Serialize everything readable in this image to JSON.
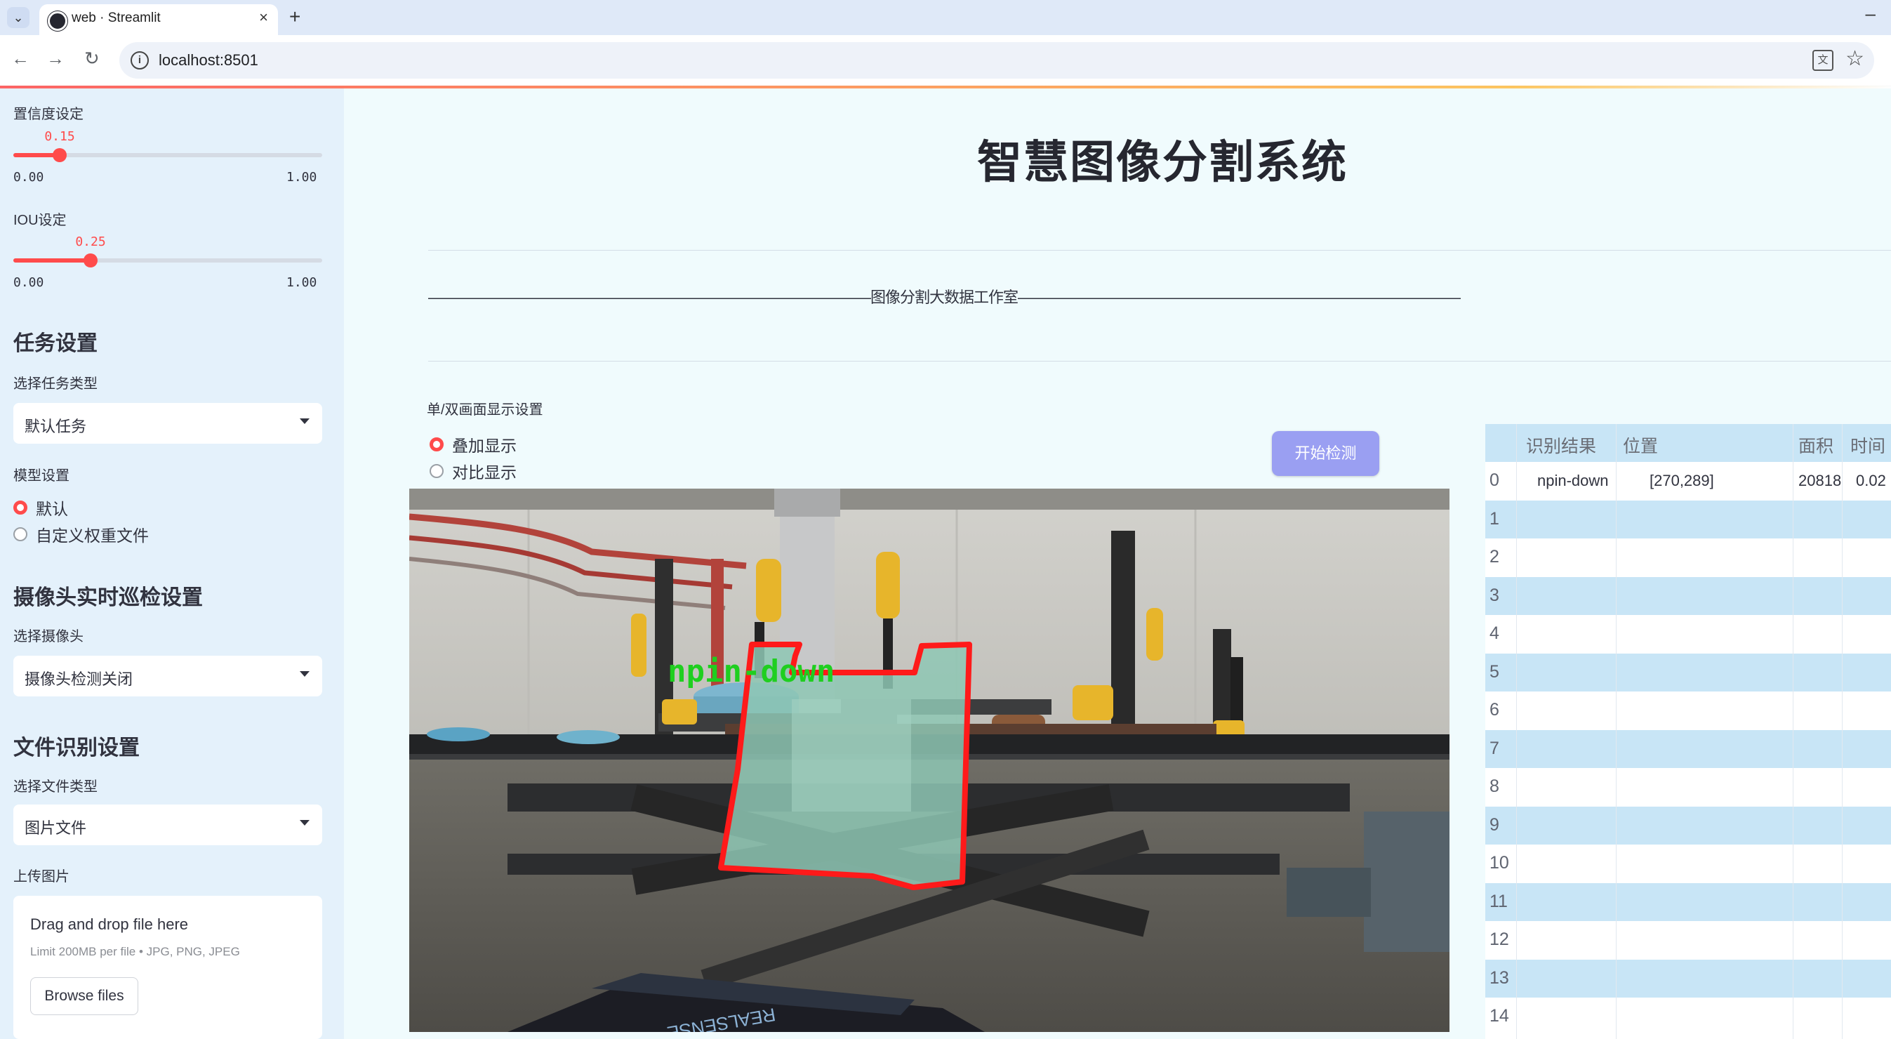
{
  "browser": {
    "tab_title": "web · Streamlit",
    "tab_close": "×",
    "new_tab": "+",
    "minimize": "–",
    "url": "localhost:8501",
    "back": "←",
    "forward": "→",
    "reload": "↻",
    "info_glyph": "i",
    "translate_glyph": "文",
    "star_glyph": "☆"
  },
  "sidebar": {
    "confidence": {
      "label": "置信度设定",
      "value": "0.15",
      "value_fraction": 0.15,
      "min": "0.00",
      "max": "1.00"
    },
    "iou": {
      "label": "IOU设定",
      "value": "0.25",
      "value_fraction": 0.25,
      "min": "0.00",
      "max": "1.00"
    },
    "task_heading": "任务设置",
    "task_type_label": "选择任务类型",
    "task_type_value": "默认任务",
    "model_label": "模型设置",
    "model_options": [
      {
        "label": "默认",
        "selected": true
      },
      {
        "label": "自定义权重文件",
        "selected": false
      }
    ],
    "camera_heading": "摄像头实时巡检设置",
    "camera_label": "选择摄像头",
    "camera_value": "摄像头检测关闭",
    "file_heading": "文件识别设置",
    "file_type_label": "选择文件类型",
    "file_type_value": "图片文件",
    "upload_label": "上传图片",
    "upload": {
      "drop_text": "Drag and drop file here",
      "limit_text": "Limit 200MB per file • JPG, PNG, JPEG",
      "browse_label": "Browse files"
    }
  },
  "main": {
    "title": "智慧图像分割系统",
    "banner": "——————————————————————————————图像分割大数据工作室——————————————————————————————",
    "display_label": "单/双画面显示设置",
    "display_options": [
      {
        "label": "叠加显示",
        "selected": true
      },
      {
        "label": "对比显示",
        "selected": false
      }
    ],
    "detect_button": "开始检测",
    "detection_label": "npin-down"
  },
  "table": {
    "columns": [
      "识别结果",
      "位置",
      "面积",
      "时间"
    ],
    "rows": [
      {
        "index": "0",
        "result": "npin-down",
        "position": "[270,289]",
        "area": "20818",
        "time": "0.02"
      },
      {
        "index": "1",
        "result": "",
        "position": "",
        "area": "",
        "time": ""
      },
      {
        "index": "2",
        "result": "",
        "position": "",
        "area": "",
        "time": ""
      },
      {
        "index": "3",
        "result": "",
        "position": "",
        "area": "",
        "time": ""
      },
      {
        "index": "4",
        "result": "",
        "position": "",
        "area": "",
        "time": ""
      },
      {
        "index": "5",
        "result": "",
        "position": "",
        "area": "",
        "time": ""
      },
      {
        "index": "6",
        "result": "",
        "position": "",
        "area": "",
        "time": ""
      },
      {
        "index": "7",
        "result": "",
        "position": "",
        "area": "",
        "time": ""
      },
      {
        "index": "8",
        "result": "",
        "position": "",
        "area": "",
        "time": ""
      },
      {
        "index": "9",
        "result": "",
        "position": "",
        "area": "",
        "time": ""
      },
      {
        "index": "10",
        "result": "",
        "position": "",
        "area": "",
        "time": ""
      },
      {
        "index": "11",
        "result": "",
        "position": "",
        "area": "",
        "time": ""
      },
      {
        "index": "12",
        "result": "",
        "position": "",
        "area": "",
        "time": ""
      },
      {
        "index": "13",
        "result": "",
        "position": "",
        "area": "",
        "time": ""
      },
      {
        "index": "14",
        "result": "",
        "position": "",
        "area": "",
        "time": ""
      }
    ]
  },
  "colors": {
    "accent": "#ff4b4b",
    "sidebar_bg": "#e4f1fb",
    "main_bg": "#f0fbfd",
    "button_bg": "#9a9ff2",
    "table_header_bg": "#c8e5f6",
    "mask_outline": "#ff1a1a",
    "mask_label": "#1fcf1f"
  }
}
